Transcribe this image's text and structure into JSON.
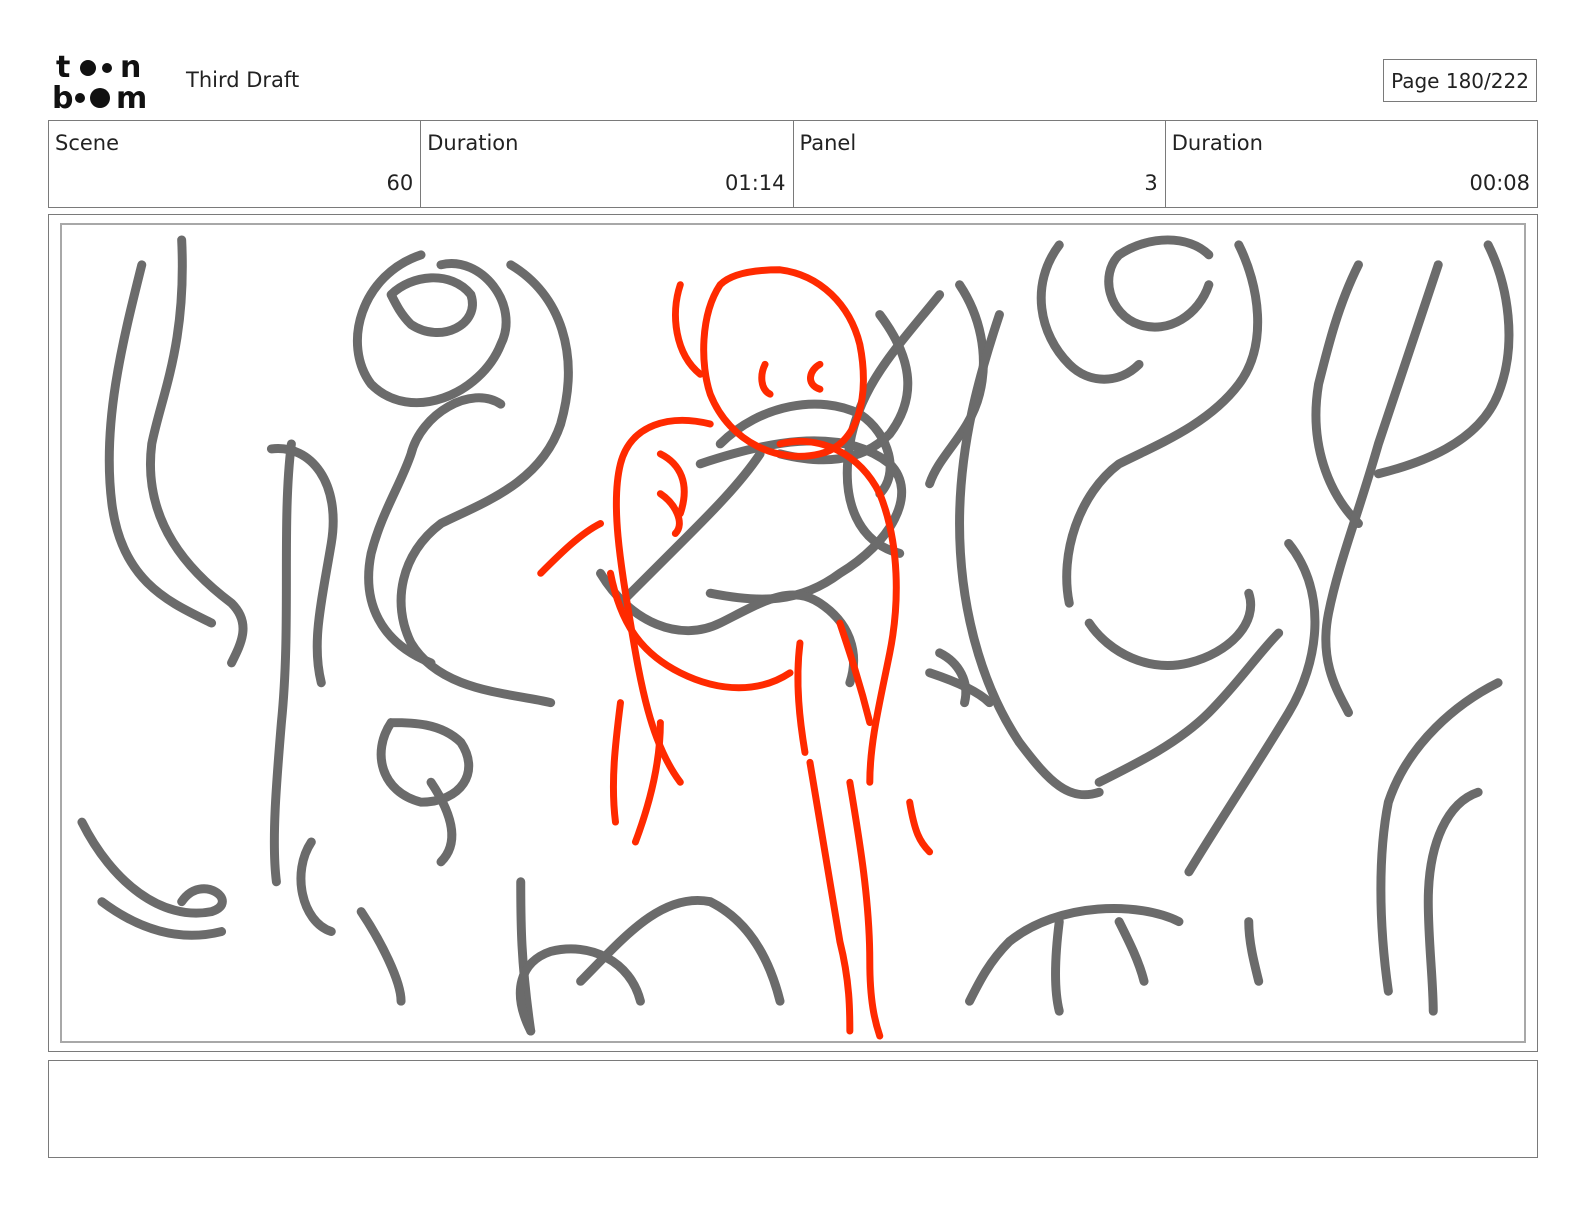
{
  "header": {
    "logo_text_top": "toon",
    "logo_text_bottom": "boom",
    "title": "Third Draft",
    "page_label": "Page 180/222"
  },
  "info": {
    "scene_label": "Scene",
    "scene_value": "60",
    "scene_duration_label": "Duration",
    "scene_duration_value": "01:14",
    "panel_label": "Panel",
    "panel_value": "3",
    "panel_duration_label": "Duration",
    "panel_duration_value": "00:08"
  },
  "panel": {
    "colors": {
      "background_lines": "#6b6b6b",
      "character_lines": "#ff2a00"
    }
  },
  "notes": {
    "text": ""
  }
}
